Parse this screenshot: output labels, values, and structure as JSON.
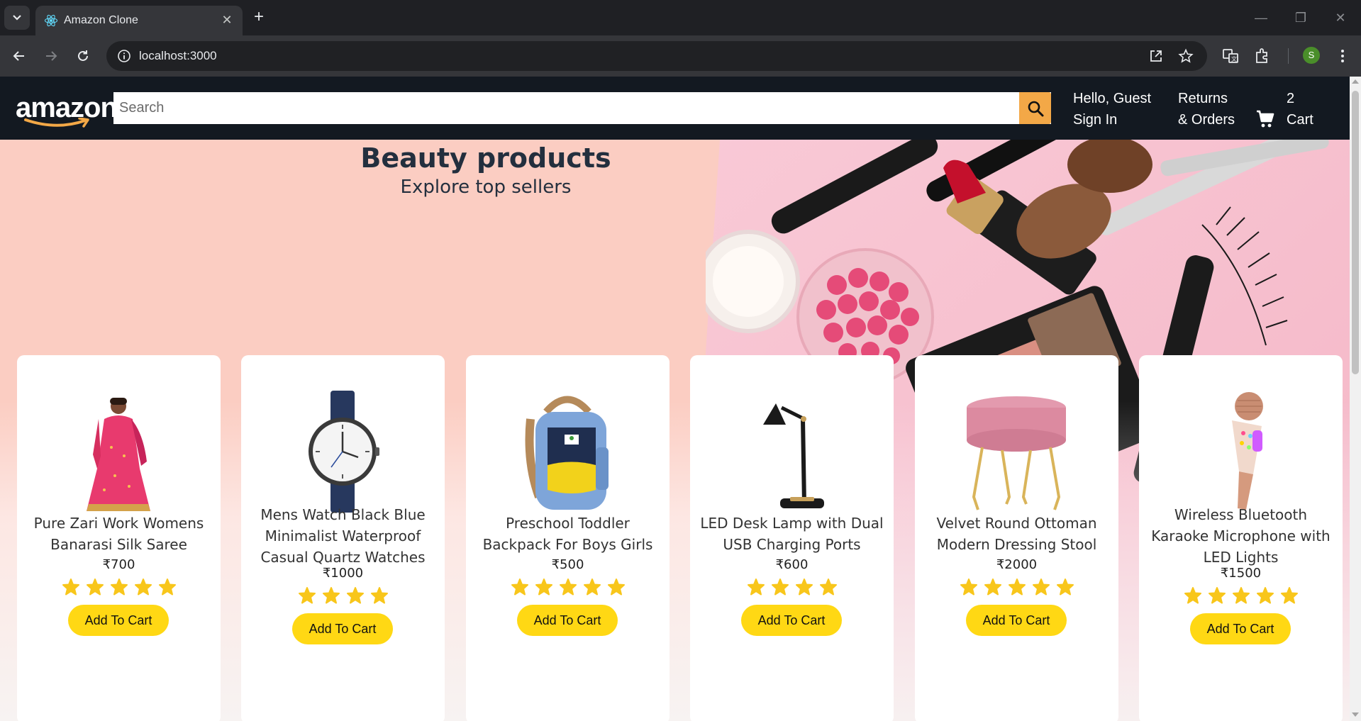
{
  "browser": {
    "tab_title": "Amazon Clone",
    "url": "localhost:3000",
    "profile_initial": "S",
    "icons": [
      "tab-search-icon",
      "react-favicon",
      "close-icon",
      "new-tab-icon",
      "back-icon",
      "forward-icon",
      "reload-icon",
      "info-icon",
      "open-in-app-icon",
      "bookmark-star-icon",
      "translate-icon",
      "extensions-icon",
      "menu-kebab-icon",
      "minimize-icon",
      "restore-icon",
      "window-close-icon"
    ]
  },
  "header": {
    "logo": "amazon",
    "search_placeholder": "Search",
    "greeting": "Hello, Guest",
    "sign_in": "Sign In",
    "returns_line1": "Returns",
    "returns_line2": "& Orders",
    "cart_count": "2",
    "cart_label": "Cart",
    "accent_color": "#f3a847",
    "bg_color": "#131921"
  },
  "hero": {
    "title": "Beauty products",
    "subtitle": "Explore top sellers"
  },
  "products": [
    {
      "title_l1": "Pure Zari Work Womens",
      "title_l2": "Banarasi Silk Saree",
      "title_l3": "",
      "price": "₹700",
      "rating": 5,
      "button": "Add To Cart"
    },
    {
      "title_l1": "Mens Watch Black Blue",
      "title_l2": "Minimalist Waterproof",
      "title_l3": "Casual Quartz Watches",
      "price": "₹1000",
      "rating": 4,
      "button": "Add To Cart"
    },
    {
      "title_l1": "Preschool Toddler",
      "title_l2": "Backpack For Boys Girls",
      "title_l3": "",
      "price": "₹500",
      "rating": 5,
      "button": "Add To Cart"
    },
    {
      "title_l1": "LED Desk Lamp with Dual",
      "title_l2": "USB Charging Ports",
      "title_l3": "",
      "price": "₹600",
      "rating": 4,
      "button": "Add To Cart"
    },
    {
      "title_l1": "Velvet Round Ottoman",
      "title_l2": "Modern Dressing Stool",
      "title_l3": "",
      "price": "₹2000",
      "rating": 5,
      "button": "Add To Cart"
    },
    {
      "title_l1": "Wireless Bluetooth",
      "title_l2": "Karaoke Microphone with",
      "title_l3": "LED Lights",
      "price": "₹1500",
      "rating": 5,
      "button": "Add To Cart"
    }
  ],
  "colors": {
    "button_yellow": "#ffd814",
    "star_yellow": "#f8c61b"
  }
}
